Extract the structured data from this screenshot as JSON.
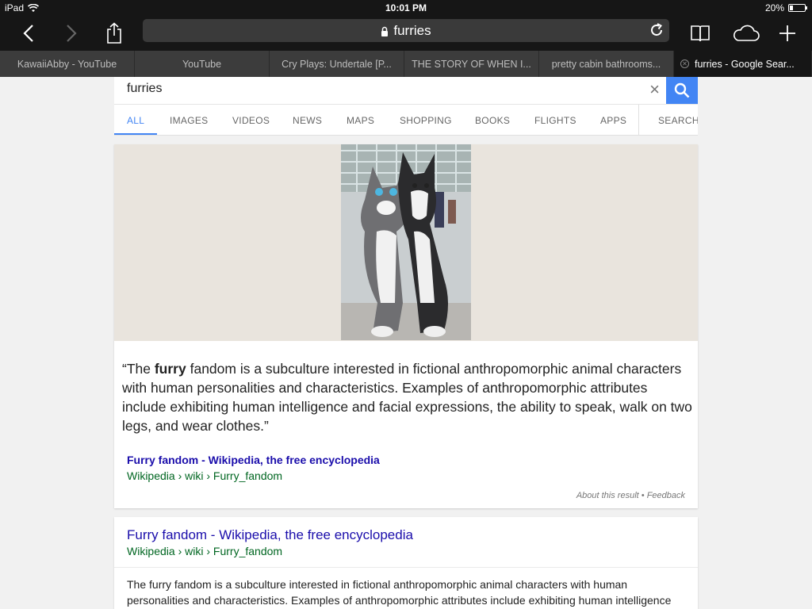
{
  "status_bar": {
    "device": "iPad",
    "time": "10:01 PM",
    "battery_text": "20%",
    "battery_level": 0.2
  },
  "toolbar": {
    "back_icon": "chevron-left-icon",
    "forward_icon": "chevron-right-icon",
    "share_icon": "share-icon",
    "url": "furries",
    "reading_list_icon": "book-icon",
    "cloud_tabs_icon": "cloud-icon",
    "new_tab_icon": "plus-icon"
  },
  "tabs": [
    {
      "label": "KawaiiAbby - YouTube"
    },
    {
      "label": "YouTube"
    },
    {
      "label": "Cry Plays: Undertale [P..."
    },
    {
      "label": "THE STORY OF WHEN I..."
    },
    {
      "label": "pretty cabin bathrooms..."
    },
    {
      "label": "furries - Google Sear..."
    }
  ],
  "search": {
    "query": "furries",
    "clear_label": "×"
  },
  "nav": [
    "ALL",
    "IMAGES",
    "VIDEOS",
    "NEWS",
    "MAPS",
    "SHOPPING",
    "BOOKS",
    "FLIGHTS",
    "APPS",
    "SEARCH"
  ],
  "featured": {
    "quote_open": "“The ",
    "quote_bold": "furry",
    "quote_rest": " fandom is a subculture interested in fictional anthropomorphic animal characters with human personalities and characteristics. Examples of anthropomorphic attributes include exhibiting human intelligence and facial expressions, the ability to speak, walk on two legs, and wear clothes.”",
    "source_title": "Furry fandom - Wikipedia, the free encyclopedia",
    "source_url": "Wikipedia › wiki › Furry_fandom",
    "about": "About this result",
    "separator": "•",
    "feedback": "Feedback"
  },
  "result": {
    "title": "Furry fandom - Wikipedia, the free encyclopedia",
    "url": "Wikipedia › wiki › Furry_fandom",
    "snippet": "The furry fandom is a subculture interested in fictional anthropomorphic animal characters with human personalities and characteristics. Examples of anthropomorphic attributes include exhibiting human intelligence"
  },
  "colors": {
    "accent": "#4285f4",
    "link": "#1a0dab",
    "url_green": "#006621"
  }
}
